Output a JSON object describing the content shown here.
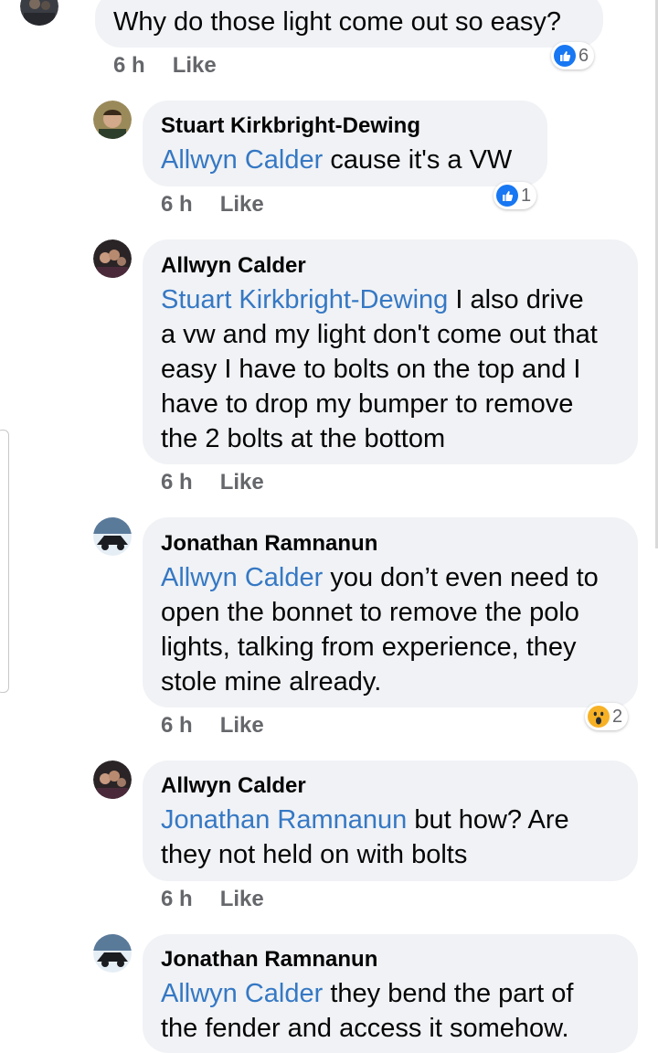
{
  "comments": [
    {
      "text": "Why do those light come out so easy?",
      "time": "6 h",
      "like_label": "Like",
      "reaction": {
        "icon": "like-icon",
        "count": "6"
      }
    },
    {
      "author": "Stuart Kirkbright-Dewing",
      "mention": "Allwyn Calder",
      "lines": [
        " cause it's a VW"
      ],
      "time": "6 h",
      "like_label": "Like",
      "reaction": {
        "icon": "like-icon",
        "count": "1"
      }
    },
    {
      "author": "Allwyn Calder",
      "mention": "Stuart Kirkbright-Dewing",
      "lines": [
        " I also drive",
        "a vw and my light don't come out that",
        "easy I have to bolts on the top and I",
        "have to drop my bumper to remove",
        "the 2 bolts at the bottom"
      ],
      "time": "6 h",
      "like_label": "Like"
    },
    {
      "author": "Jonathan Ramnanun",
      "mention": "Allwyn Calder",
      "lines": [
        " you don’t even need to",
        "open the bonnet to remove the polo",
        "lights, talking from experience, they",
        "stole mine already."
      ],
      "time": "6 h",
      "like_label": "Like",
      "reaction": {
        "icon": "wow-icon",
        "count": "2"
      }
    },
    {
      "author": "Allwyn Calder",
      "mention": "Jonathan Ramnanun",
      "lines": [
        " but how? Are",
        "they not held on with bolts"
      ],
      "time": "6 h",
      "like_label": "Like"
    },
    {
      "author": "Jonathan Ramnanun",
      "mention": "Allwyn Calder",
      "lines": [
        " they bend the part of",
        "the fender and access it somehow."
      ]
    }
  ],
  "colors": {
    "bubble": "#f0f2f5",
    "mention": "#3578c4",
    "meta": "#65676b",
    "like_blue": "#1877f2",
    "wow_yellow": "#f7b125"
  }
}
